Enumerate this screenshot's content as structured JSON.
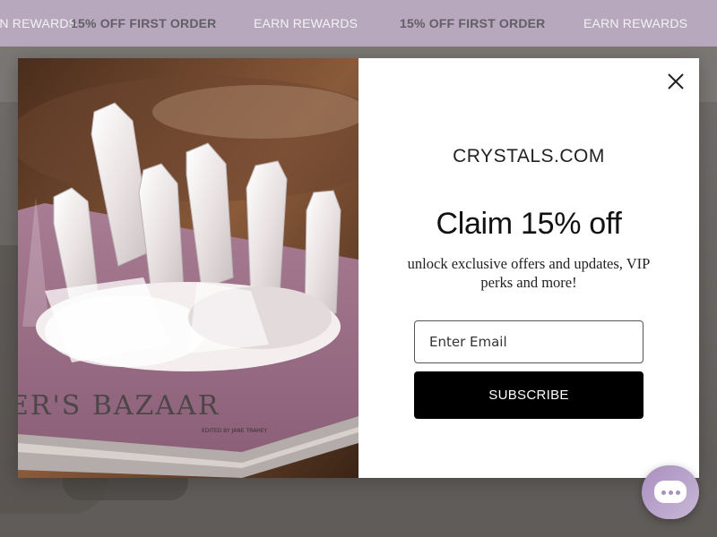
{
  "announcement": {
    "items": [
      {
        "text": "EARN REWARDS",
        "style": "light"
      },
      {
        "text": "15% OFF FIRST ORDER",
        "style": "bold"
      },
      {
        "text": "EARN REWARDS",
        "style": "light"
      },
      {
        "text": "15% OFF FIRST ORDER",
        "style": "bold"
      },
      {
        "text": "EARN REWARDS",
        "style": "light"
      }
    ]
  },
  "modal": {
    "brand": "CRYSTALS.COM",
    "headline": "Claim 15% off",
    "subtext": "unlock exclusive offers and updates, VIP perks and more!",
    "email_placeholder": "Enter Email",
    "email_value": "",
    "subscribe_label": "SUBSCRIBE",
    "close_icon": "close-icon",
    "image": {
      "book_title": "ER'S BAZAAR",
      "book_subtitle": "EDITED BY JANE TRAHEY"
    }
  },
  "chat": {
    "icon": "chat-bubble-icon"
  },
  "colors": {
    "announcement_bg": "#b7a8bd",
    "button_bg": "#000000",
    "chat_accent": "#a98fbf"
  }
}
